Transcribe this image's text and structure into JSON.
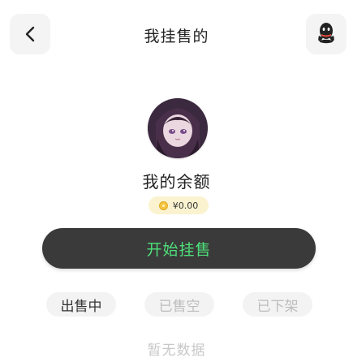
{
  "header": {
    "title": "我挂售的",
    "back_icon": "chevron-left-icon",
    "right_icon": "qq-icon"
  },
  "profile": {
    "avatar": "avatar",
    "balance_label": "我的余额",
    "balance_value": "¥0.00",
    "coin_icon": "coin-icon"
  },
  "actions": {
    "start_label": "开始挂售",
    "start_text_color": "#4ee07a"
  },
  "tabs": [
    {
      "label": "出售中",
      "active": true
    },
    {
      "label": "已售空",
      "active": false
    },
    {
      "label": "已下架",
      "active": false
    }
  ],
  "empty": {
    "text": "暂无数据"
  }
}
